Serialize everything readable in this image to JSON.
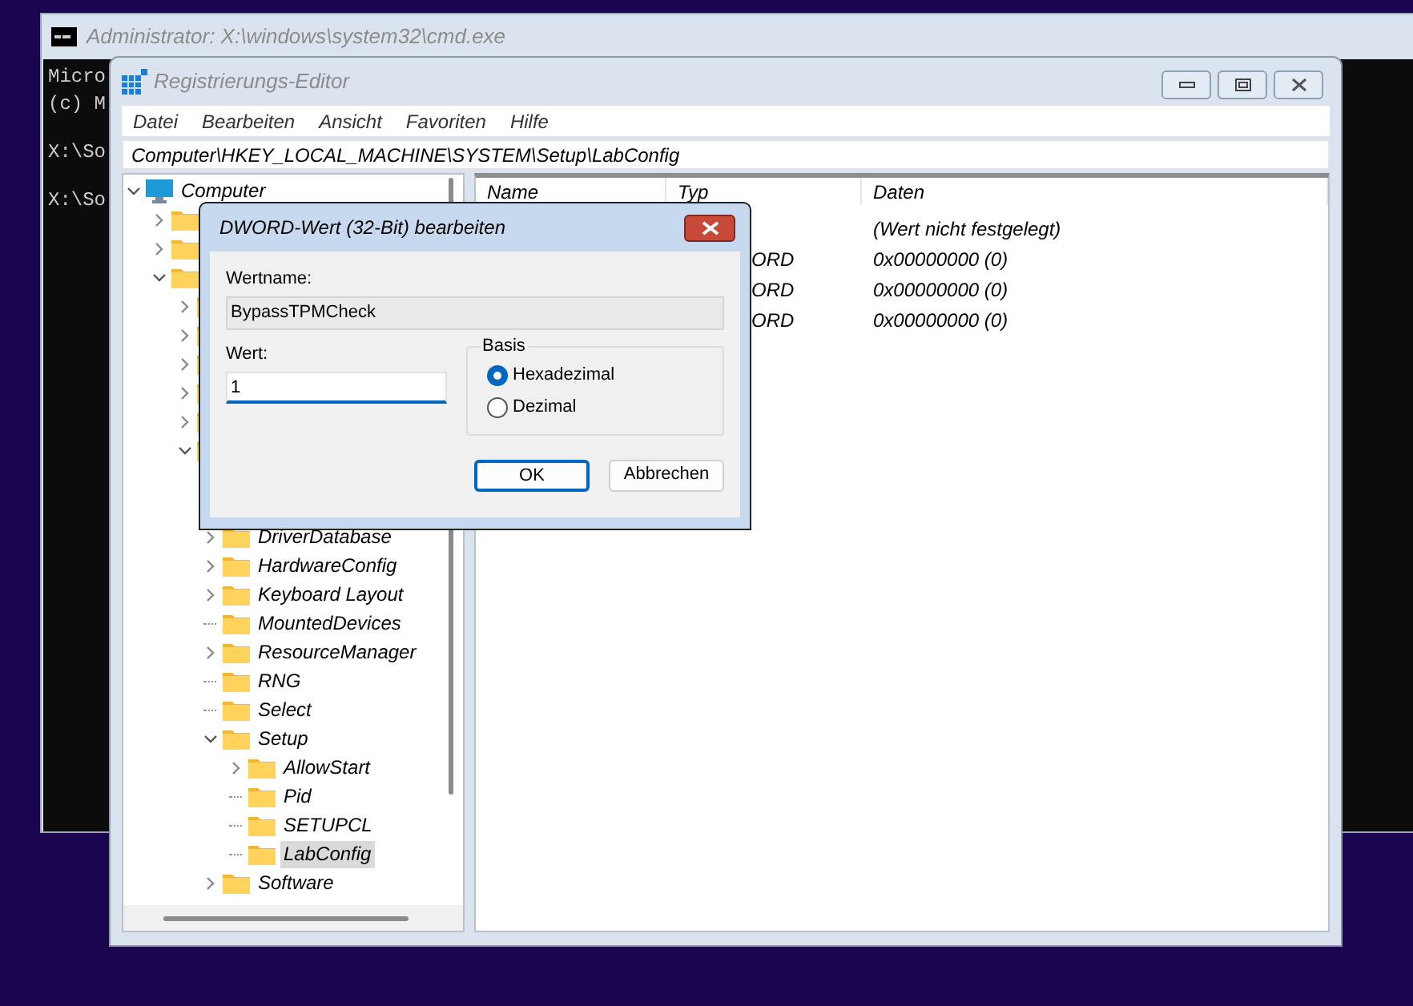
{
  "cmd_window": {
    "title": "Administrator: X:\\windows\\system32\\cmd.exe",
    "blocks": [
      [
        "Micro",
        "(c) M"
      ],
      [
        "X:\\So"
      ],
      [
        "X:\\So"
      ]
    ]
  },
  "regedit_window": {
    "title": "Registrierungs-Editor",
    "menu": [
      "Datei",
      "Bearbeiten",
      "Ansicht",
      "Favoriten",
      "Hilfe"
    ],
    "address": "Computer\\HKEY_LOCAL_MACHINE\\SYSTEM\\Setup\\LabConfig",
    "tree": [
      {
        "name": "Computer",
        "kind": "computer",
        "expanded": true,
        "selected": false,
        "children": [
          {
            "kind": "folder",
            "expanded": false
          },
          {
            "kind": "folder",
            "expanded": false
          },
          {
            "kind": "folder",
            "expanded": true,
            "children": [
              {
                "kind": "folder",
                "expanded": false
              },
              {
                "kind": "folder",
                "expanded": false
              },
              {
                "kind": "folder",
                "expanded": false
              },
              {
                "kind": "folder",
                "expanded": false
              },
              {
                "kind": "folder",
                "expanded": false
              },
              {
                "kind": "folder",
                "expanded": true,
                "children": [
                  {
                    "name": "DriverDatabase",
                    "kind": "folder",
                    "expanded": false,
                    "selected": false
                  },
                  {
                    "name": "HardwareConfig",
                    "kind": "folder",
                    "expanded": false,
                    "selected": false
                  },
                  {
                    "name": "Keyboard Layout",
                    "kind": "folder",
                    "expanded": false,
                    "selected": false
                  },
                  {
                    "name": "MountedDevices",
                    "kind": "folder",
                    "selected": false
                  },
                  {
                    "name": "ResourceManager",
                    "kind": "folder",
                    "expanded": false,
                    "selected": false
                  },
                  {
                    "name": "RNG",
                    "kind": "folder",
                    "selected": false
                  },
                  {
                    "name": "Select",
                    "kind": "folder",
                    "selected": false
                  },
                  {
                    "name": "Setup",
                    "kind": "folder",
                    "expanded": true,
                    "selected": false,
                    "children": [
                      {
                        "name": "AllowStart",
                        "kind": "folder",
                        "expanded": false,
                        "selected": false
                      },
                      {
                        "name": "Pid",
                        "kind": "folder",
                        "selected": false
                      },
                      {
                        "name": "SETUPCL",
                        "kind": "folder",
                        "selected": false
                      },
                      {
                        "name": "LabConfig",
                        "kind": "folder",
                        "selected": true
                      }
                    ]
                  },
                  {
                    "name": "Software",
                    "kind": "folder",
                    "expanded": false,
                    "selected": false
                  }
                ]
              }
            ]
          }
        ]
      }
    ],
    "list": {
      "columns": [
        "Name",
        "Typ",
        "Daten"
      ],
      "rows": [
        {
          "data": "(Wert nicht festgelegt)"
        },
        {
          "type": "ORD",
          "data": "0x00000000 (0)"
        },
        {
          "type": "ORD",
          "data": "0x00000000 (0)"
        },
        {
          "type": "ORD",
          "data": "0x00000000 (0)"
        }
      ]
    }
  },
  "dialog": {
    "title": "DWORD-Wert (32-Bit) bearbeiten",
    "value_name_label": "Wertname:",
    "value_name": "BypassTPMCheck",
    "value_label": "Wert:",
    "value": "1",
    "base_label": "Basis",
    "bases": [
      {
        "label": "Hexadezimal",
        "selected": true
      },
      {
        "label": "Dezimal",
        "selected": false
      }
    ],
    "buttons": [
      {
        "label": "OK",
        "default": true
      },
      {
        "label": "Abbrechen",
        "default": false
      }
    ]
  }
}
